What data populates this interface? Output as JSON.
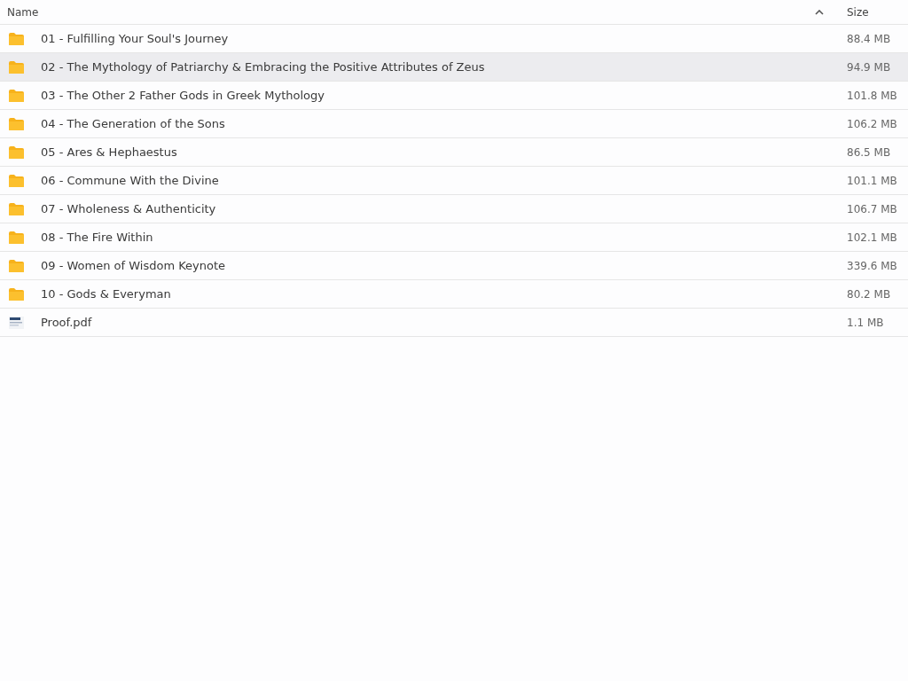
{
  "columns": {
    "name": "Name",
    "size": "Size",
    "sort_ascending": true
  },
  "rows": [
    {
      "kind": "folder",
      "name": "01 - Fulfilling Your Soul's Journey",
      "size": "88.4 MB",
      "hovered": false
    },
    {
      "kind": "folder",
      "name": "02 - The Mythology of Patriarchy & Embracing the Positive Attributes of Zeus",
      "size": "94.9 MB",
      "hovered": true
    },
    {
      "kind": "folder",
      "name": "03 - The Other 2 Father Gods in Greek Mythology",
      "size": "101.8 MB",
      "hovered": false
    },
    {
      "kind": "folder",
      "name": "04 - The Generation of the Sons",
      "size": "106.2 MB",
      "hovered": false
    },
    {
      "kind": "folder",
      "name": "05 - Ares & Hephaestus",
      "size": "86.5 MB",
      "hovered": false
    },
    {
      "kind": "folder",
      "name": "06 - Commune With the Divine",
      "size": "101.1 MB",
      "hovered": false
    },
    {
      "kind": "folder",
      "name": "07 - Wholeness & Authenticity",
      "size": "106.7 MB",
      "hovered": false
    },
    {
      "kind": "folder",
      "name": "08 - The Fire Within",
      "size": "102.1 MB",
      "hovered": false
    },
    {
      "kind": "folder",
      "name": "09 - Women of Wisdom Keynote",
      "size": "339.6 MB",
      "hovered": false
    },
    {
      "kind": "folder",
      "name": "10 - Gods & Everyman",
      "size": "80.2 MB",
      "hovered": false
    },
    {
      "kind": "pdf",
      "name": "Proof.pdf",
      "size": "1.1 MB",
      "hovered": false
    }
  ]
}
